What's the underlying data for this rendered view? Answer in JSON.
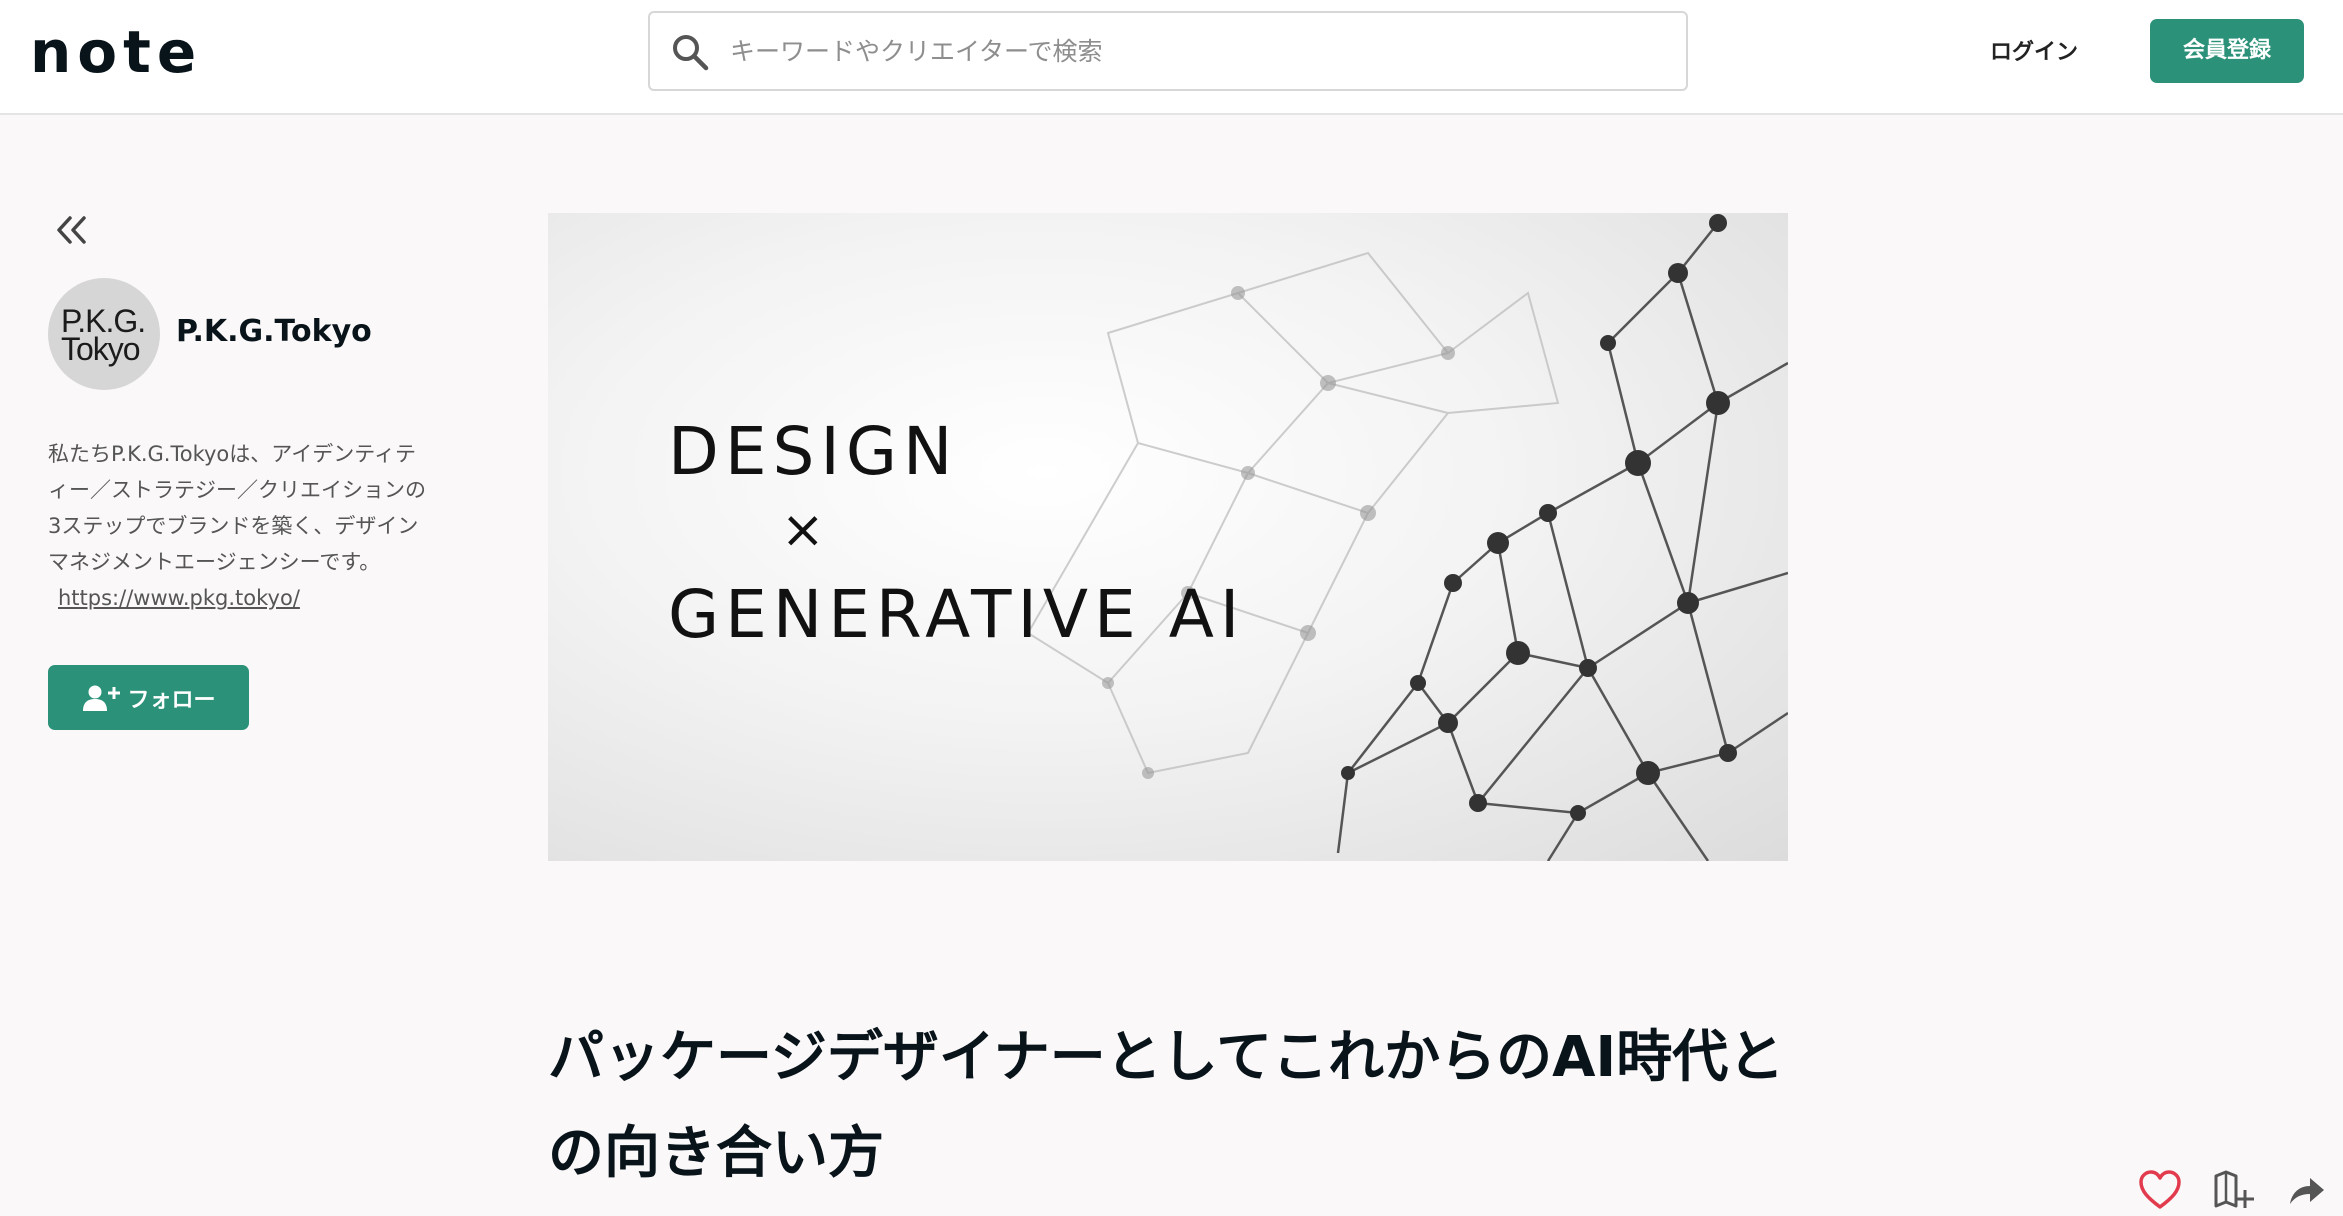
{
  "header": {
    "logo": "note",
    "search_placeholder": "キーワードやクリエイターで検索",
    "login_label": "ログイン",
    "signup_label": "会員登録"
  },
  "sidebar": {
    "avatar_text_line1": "P.K.G.",
    "avatar_text_line2": "Tokyo",
    "creator_name": "P.K.G.Tokyo",
    "bio": "私たちP.K.G.Tokyoは、アイデンティティー／ストラテジー／クリエイションの3ステップでブランドを築く、デザインマネジメントエージェンシーです。",
    "bio_link": "https://www.pkg.tokyo/",
    "follow_label": "フォロー"
  },
  "article": {
    "hero_line1": "DESIGN",
    "hero_x": "×",
    "hero_line2": "GENERATIVE AI",
    "title": "パッケージデザイナーとしてこれからのAI時代との向き合い方"
  },
  "colors": {
    "accent": "#2b9178",
    "like": "#e23b4d"
  },
  "icons": {
    "search": "search-icon",
    "collapse": "double-chevron-left-icon",
    "follow": "user-plus-icon",
    "like": "heart-icon",
    "bookmark": "bookmark-plus-icon",
    "share": "share-arrow-icon"
  }
}
